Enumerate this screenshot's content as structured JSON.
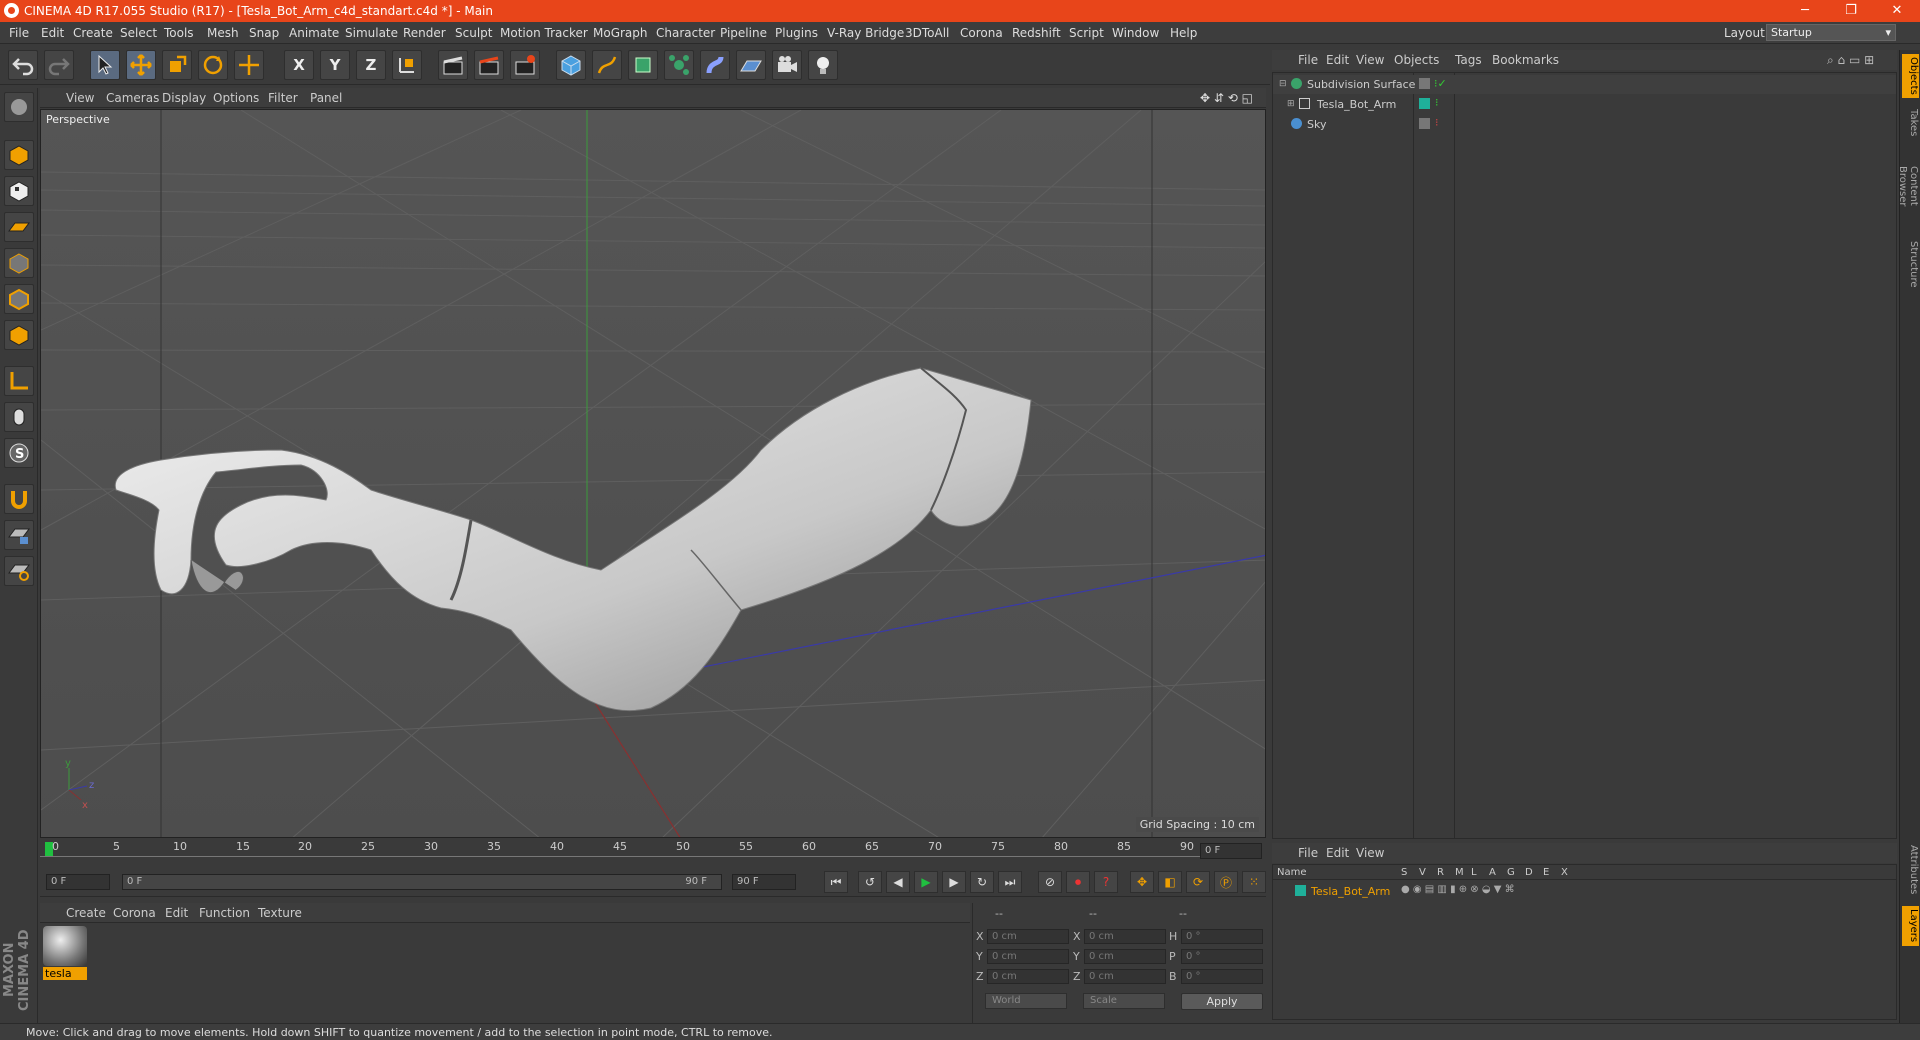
{
  "window": {
    "title": "CINEMA 4D R17.055 Studio (R17) - [Tesla_Bot_Arm_c4d_standart.c4d *] - Main",
    "minimize": "─",
    "maximize": "❐",
    "close": "✕"
  },
  "menubar": {
    "items": [
      "File",
      "Edit",
      "Create",
      "Select",
      "Tools",
      "Mesh",
      "Snap",
      "Animate",
      "Simulate",
      "Render",
      "Sculpt",
      "Motion Tracker",
      "MoGraph",
      "Character",
      "Pipeline",
      "Plugins",
      "V-Ray Bridge",
      "3DToAll",
      "Corona",
      "Redshift",
      "Script",
      "Window",
      "Help"
    ],
    "layout_label": "Layout:",
    "layout_value": "Startup"
  },
  "toolbar": {
    "axis_x": "X",
    "axis_y": "Y",
    "axis_z": "Z"
  },
  "viewport": {
    "menu": [
      "View",
      "Cameras",
      "Display",
      "Options",
      "Filter",
      "Panel"
    ],
    "label": "Perspective",
    "grid_spacing": "Grid Spacing : 10 cm",
    "axis_labels": {
      "y": "y",
      "z": "z",
      "x": "x"
    }
  },
  "timeline": {
    "ticks": [
      "0",
      "5",
      "10",
      "15",
      "20",
      "25",
      "30",
      "35",
      "40",
      "45",
      "50",
      "55",
      "60",
      "65",
      "70",
      "75",
      "80",
      "85",
      "90"
    ],
    "current_frame": "0 F",
    "start_field": "0 F",
    "range_start": "0 F",
    "range_end": "90 F",
    "end_field": "90 F"
  },
  "material_manager": {
    "menu": [
      "Create",
      "Corona",
      "Edit",
      "Function",
      "Texture"
    ],
    "materials": [
      {
        "name": "tesla"
      }
    ]
  },
  "coordinates": {
    "headers": [
      "--",
      "--",
      "--"
    ],
    "rows": [
      {
        "pos_label": "X",
        "pos_value": "0 cm",
        "size_label": "X",
        "size_value": "0 cm",
        "rot_label": "H",
        "rot_value": "0 °"
      },
      {
        "pos_label": "Y",
        "pos_value": "0 cm",
        "size_label": "Y",
        "size_value": "0 cm",
        "rot_label": "P",
        "rot_value": "0 °"
      },
      {
        "pos_label": "Z",
        "pos_value": "0 cm",
        "size_label": "Z",
        "size_value": "0 cm",
        "rot_label": "B",
        "rot_value": "0 °"
      }
    ],
    "mode_dropdown": "World",
    "scale_dropdown": "Scale",
    "apply_label": "Apply"
  },
  "status": {
    "text": "Move: Click and drag to move elements. Hold down SHIFT to quantize movement / add to the selection in point mode, CTRL to remove."
  },
  "object_manager": {
    "menu": [
      "File",
      "Edit",
      "View",
      "Objects",
      "Tags",
      "Bookmarks"
    ],
    "objects": [
      {
        "name": "Subdivision Surface",
        "color": "#3aa36a"
      },
      {
        "name": "Tesla_Bot_Arm",
        "color": "#aaaaaa"
      },
      {
        "name": "Sky",
        "color": "#4a8fd0"
      }
    ]
  },
  "layer_manager": {
    "menu": [
      "File",
      "Edit",
      "View"
    ],
    "columns": [
      "Name",
      "S",
      "V",
      "R",
      "M",
      "L",
      "A",
      "G",
      "D",
      "E",
      "X"
    ],
    "layers": [
      {
        "name": "Tesla_Bot_Arm",
        "color": "#1fb09a"
      }
    ]
  },
  "right_tabs": [
    "Objects",
    "Takes",
    "Content Browser",
    "Structure",
    "Attributes",
    "Layers"
  ],
  "branding": "MAXON CINEMA 4D"
}
